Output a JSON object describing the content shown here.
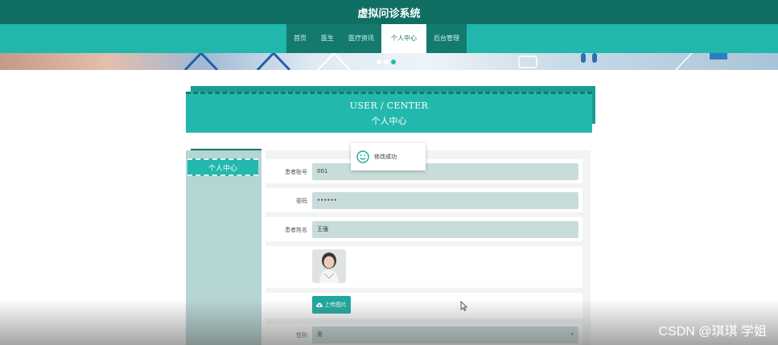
{
  "app": {
    "title": "虚拟问诊系统"
  },
  "nav": {
    "items": [
      {
        "label": "首页"
      },
      {
        "label": "医生"
      },
      {
        "label": "医疗资讯"
      },
      {
        "label": "个人中心"
      },
      {
        "label": "后台管理"
      }
    ],
    "active_index": 3
  },
  "banner": {
    "carousel_count": 3,
    "carousel_active": 2
  },
  "section": {
    "title_en": "USER / CENTER",
    "title_cn": "个人中心"
  },
  "sidebar": {
    "items": [
      {
        "label": "个人中心"
      }
    ]
  },
  "form": {
    "account_label": "患者账号",
    "account_value": "001",
    "password_label": "密码",
    "password_value": "••••••",
    "name_label": "患者姓名",
    "name_value": "王强",
    "upload_label": "上传图片",
    "gender_label": "性别",
    "gender_value": "男"
  },
  "toast": {
    "message": "修改成功",
    "icon": "smile-icon"
  },
  "watermark": {
    "text": "CSDN @琪琪 学姐"
  },
  "colors": {
    "header": "#116e63",
    "nav_bar": "#22b7ad",
    "accent": "#23b8ad",
    "sidebar": "#b5d5d3",
    "field": "#c8dcdb"
  }
}
